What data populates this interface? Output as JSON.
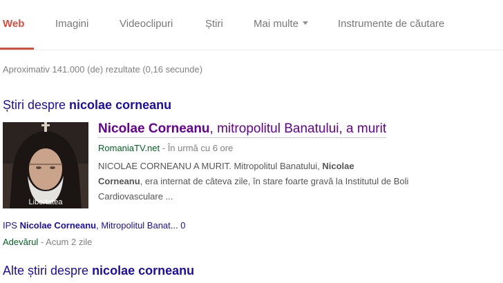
{
  "tabs": [
    {
      "label": "Web",
      "active": true
    },
    {
      "label": "Imagini"
    },
    {
      "label": "Videoclipuri"
    },
    {
      "label": "Știri"
    },
    {
      "label": "Mai multe"
    },
    {
      "label": "Instrumente de căutare"
    }
  ],
  "stats": "Aproximativ 141.000 (de) rezultate (0,16 secunde)",
  "news_section": {
    "prefix": "Știri despre ",
    "query": "nicolae corneanu"
  },
  "top_story": {
    "thumbnail_caption": "Libertatea",
    "title_bold": "Nicolae Corneanu",
    "title_rest": ", mitropolitul Banatului, a murit",
    "source": "RomaniaTV.net",
    "time": " - În urmă cu 6 ore",
    "snippet_1": "NICOLAE CORNEANU A MURIT. Mitropolitul Banatului, ",
    "snippet_bold_1": "Nicolae",
    "snippet_bold_2": "Corneanu",
    "snippet_2": ", era internat de câteva zile, în stare foarte gravă la Institutul de Boli Cardiovasculare ..."
  },
  "related_story": {
    "prefix": "IPS ",
    "bold": "Nicolae Corneanu",
    "rest": ", Mitropolitul Banat... 0",
    "source": "Adevărul",
    "time": " - Acum 2 zile"
  },
  "more_news": {
    "prefix": "Alte știri despre ",
    "query": "nicolae corneanu"
  },
  "colors": {
    "accent": "#dd4b39",
    "link": "#1a0dab",
    "visited": "#660099",
    "source_green": "#006621"
  },
  "icons": [
    "chevron-down-icon"
  ]
}
